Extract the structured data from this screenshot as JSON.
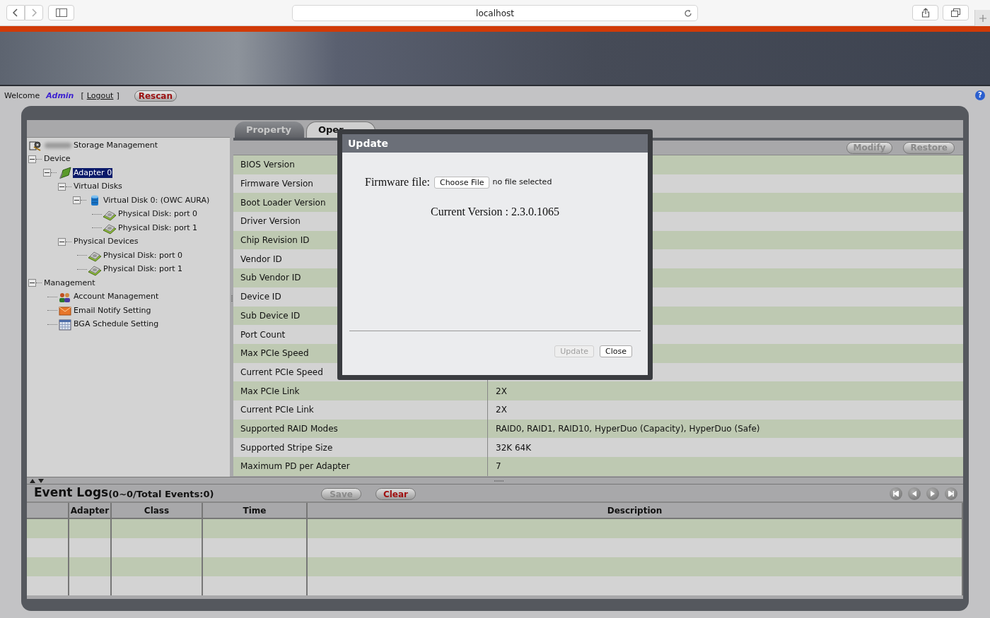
{
  "browser": {
    "url": "localhost"
  },
  "top_bar": {
    "welcome": "Welcome",
    "user": "Admin",
    "logout_open": "[",
    "logout": "Logout",
    "logout_close": "]",
    "rescan": "Rescan",
    "help": "?"
  },
  "tree": {
    "label": "Storage Management",
    "kind": "manager",
    "selected": false,
    "children": [
      {
        "label": "Device",
        "expanded": true,
        "selected": false,
        "children": [
          {
            "label": "Adapter 0",
            "kind": "adapter",
            "expanded": true,
            "selected": true,
            "children": [
              {
                "label": "Virtual Disks",
                "expanded": true,
                "selected": false,
                "children": [
                  {
                    "label": "Virtual Disk 0: (OWC AURA)",
                    "kind": "virtual-disk",
                    "expanded": true,
                    "selected": false,
                    "children": [
                      {
                        "label": "Physical Disk: port 0",
                        "kind": "disk",
                        "selected": false
                      },
                      {
                        "label": "Physical Disk: port 1",
                        "kind": "disk",
                        "selected": false
                      }
                    ]
                  }
                ]
              },
              {
                "label": "Physical Devices",
                "expanded": true,
                "selected": false,
                "children": [
                  {
                    "label": "Physical Disk: port 0",
                    "kind": "disk",
                    "selected": false
                  },
                  {
                    "label": "Physical Disk: port 1",
                    "kind": "disk",
                    "selected": false
                  }
                ]
              }
            ]
          }
        ]
      },
      {
        "label": "Management",
        "expanded": true,
        "selected": false,
        "children": [
          {
            "label": "Account Management",
            "kind": "account",
            "selected": false
          },
          {
            "label": "Email Notify Setting",
            "kind": "email",
            "selected": false
          },
          {
            "label": "BGA Schedule Setting",
            "kind": "calendar",
            "selected": false
          }
        ]
      }
    ]
  },
  "tabs": [
    {
      "label": "Property",
      "selected": false
    },
    {
      "label": "Oper",
      "selected": true
    }
  ],
  "toolbar": [
    {
      "label": "Modify",
      "disabled": true
    },
    {
      "label": "Restore",
      "disabled": true
    }
  ],
  "properties": [
    {
      "label": "BIOS Version"
    },
    {
      "label": "Firmware Version"
    },
    {
      "label": "Boot Loader Version"
    },
    {
      "label": "Driver Version"
    },
    {
      "label": "Chip Revision ID"
    },
    {
      "label": "Vendor ID"
    },
    {
      "label": "Sub Vendor ID"
    },
    {
      "label": "Device ID"
    },
    {
      "label": "Sub Device ID"
    },
    {
      "label": "Port Count"
    },
    {
      "label": "Max PCIe Speed"
    },
    {
      "label": "Current PCIe Speed"
    },
    {
      "label": "Max PCIe Link",
      "value": "2X"
    },
    {
      "label": "Current PCIe Link",
      "value": "2X"
    },
    {
      "label": "Supported RAID Modes",
      "value": "RAID0, RAID1, RAID10, HyperDuo (Capacity), HyperDuo (Safe)"
    },
    {
      "label": "Supported Stripe Size",
      "value": "32K 64K"
    },
    {
      "label": "Maximum PD per Adapter",
      "value": "7"
    }
  ],
  "event_logs": {
    "title": "Event Logs",
    "summary": "(0~0/Total Events:0)",
    "buttons": [
      {
        "label": "Save",
        "disabled": true
      },
      {
        "label": "Clear",
        "disabled": false
      }
    ],
    "columns": [
      "Adapter",
      "Class",
      "Time",
      "Description"
    ]
  },
  "dialog": {
    "title": "Update",
    "field_label": "Firmware file:",
    "choose_button": "Choose File",
    "file_status": "no file selected",
    "current_version": "Current Version : 2.3.0.1065",
    "buttons": [
      {
        "label": "Update",
        "disabled": true
      },
      {
        "label": "Close",
        "disabled": false
      }
    ]
  }
}
